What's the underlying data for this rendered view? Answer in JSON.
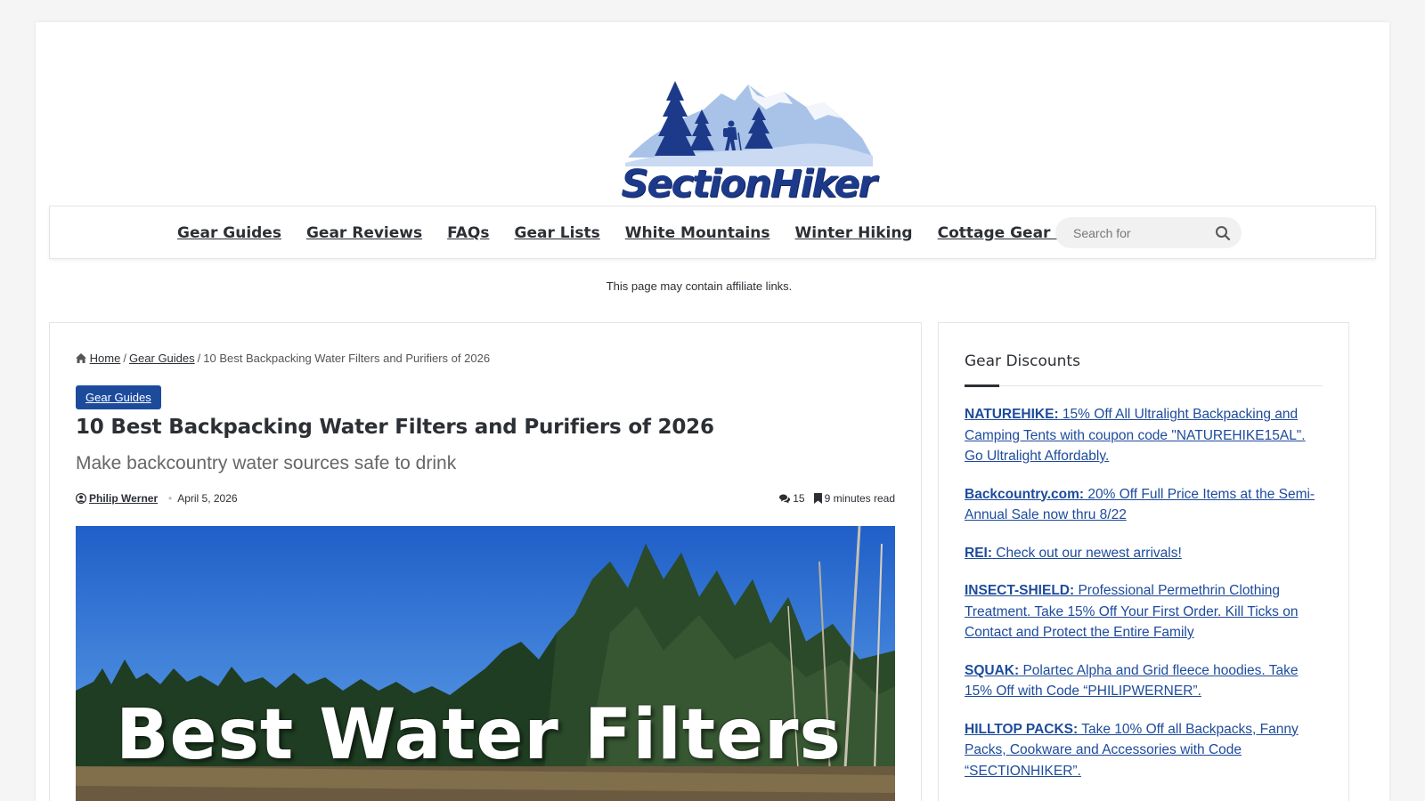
{
  "site": {
    "logo_text": "SectionHiker",
    "logo_colors": {
      "dark_blue": "#1d3a8a",
      "light_blue": "#a9c3e8"
    }
  },
  "nav": {
    "items": [
      {
        "label": "Gear Guides"
      },
      {
        "label": "Gear Reviews"
      },
      {
        "label": "FAQs"
      },
      {
        "label": "Gear Lists"
      },
      {
        "label": "White Mountains"
      },
      {
        "label": "Winter Hiking"
      },
      {
        "label": "Cottage Gear Directory"
      }
    ],
    "search_placeholder": "Search for",
    "search_icon": "search-icon"
  },
  "affiliate_notice": "This page may contain affiliate links.",
  "breadcrumb": {
    "home": "Home",
    "category": "Gear Guides",
    "current": "10 Best Backpacking Water Filters and Purifiers of 2026",
    "separator": "/"
  },
  "post": {
    "category": "Gear Guides",
    "title": "10 Best Backpacking Water Filters and Purifiers of 2026",
    "subtitle": "Make backcountry water sources safe to drink",
    "author": "Philip Werner",
    "date": "April 5, 2026",
    "comments": "15",
    "read_time": "9 minutes read",
    "hero_text": "Best Water Filters"
  },
  "sidebar": {
    "title": "Gear Discounts",
    "discounts": [
      {
        "brand": "NATUREHIKE:",
        "text": " 15% Off All Ultralight Backpacking and Camping Tents with coupon code \"NATUREHIKE15AL\". Go Ultralight Affordably."
      },
      {
        "brand": "Backcountry.com:",
        "text": " 20% Off Full Price Items at the Semi-Annual Sale now thru 8/22"
      },
      {
        "brand": "REI:",
        "text": " Check out our newest arrivals!"
      },
      {
        "brand": "INSECT-SHIELD:",
        "text": " Professional Permethrin Clothing Treatment. Take 15% Off Your First Order. Kill Ticks on Contact and Protect the Entire Family"
      },
      {
        "brand": "SQUAK:",
        "text": " Polartec Alpha and Grid fleece hoodies. Take 15% Off with Code “PHILIPWERNER”."
      },
      {
        "brand": "HILLTOP PACKS:",
        "text": " Take 10% Off all Backpacks, Fanny Packs, Cookware and Accessories with Code “SECTIONHIKER”."
      }
    ]
  },
  "colors": {
    "link_blue": "#1d4b9c",
    "text_dark": "#2c2f34",
    "badge_bg": "#1d4b9c"
  }
}
